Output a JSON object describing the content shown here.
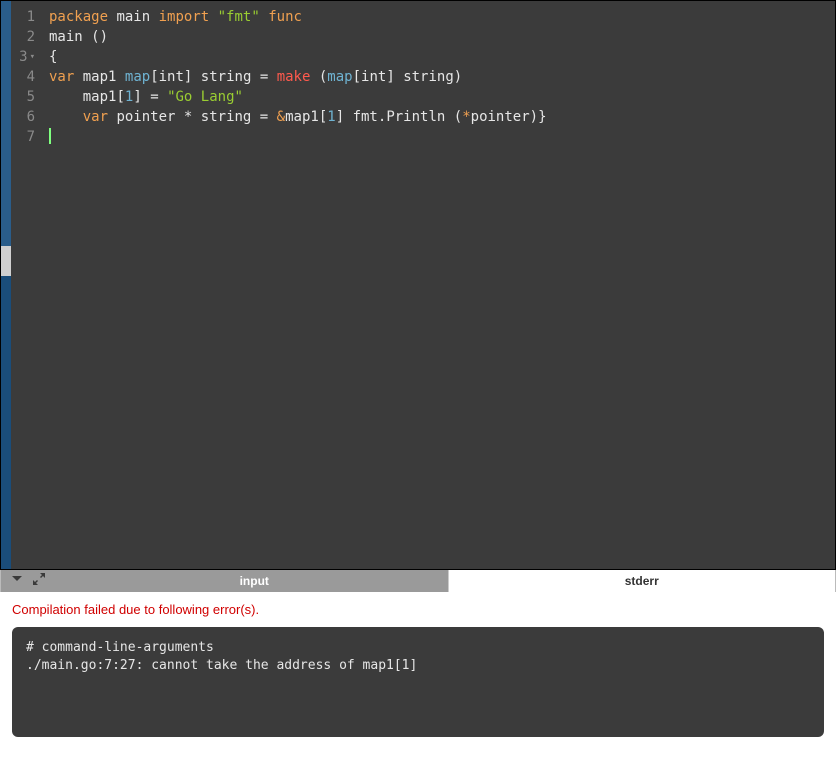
{
  "editor": {
    "lines": [
      {
        "num": "1",
        "tokens": [
          {
            "cls": "kw-package",
            "t": "package"
          },
          {
            "cls": "sp",
            "t": " "
          },
          {
            "cls": "name-main",
            "t": "main"
          },
          {
            "cls": "sp",
            "t": " "
          },
          {
            "cls": "kw-import",
            "t": "import"
          },
          {
            "cls": "sp",
            "t": " "
          },
          {
            "cls": "str",
            "t": "\"fmt\""
          },
          {
            "cls": "sp",
            "t": " "
          },
          {
            "cls": "kw-func",
            "t": "func"
          }
        ]
      },
      {
        "num": "2",
        "tokens": [
          {
            "cls": "name-main",
            "t": "main"
          },
          {
            "cls": "sp",
            "t": " "
          },
          {
            "cls": "punct",
            "t": "()"
          }
        ]
      },
      {
        "num": "3",
        "fold": true,
        "tokens": [
          {
            "cls": "punct",
            "t": "{"
          }
        ]
      },
      {
        "num": "4",
        "tokens": [
          {
            "cls": "kw-var",
            "t": "var"
          },
          {
            "cls": "sp",
            "t": " "
          },
          {
            "cls": "ident",
            "t": "map1"
          },
          {
            "cls": "sp",
            "t": " "
          },
          {
            "cls": "mapkw",
            "t": "map"
          },
          {
            "cls": "punct",
            "t": "["
          },
          {
            "cls": "ident",
            "t": "int"
          },
          {
            "cls": "punct",
            "t": "]"
          },
          {
            "cls": "sp",
            "t": " "
          },
          {
            "cls": "ident",
            "t": "string"
          },
          {
            "cls": "sp",
            "t": " "
          },
          {
            "cls": "punct",
            "t": "="
          },
          {
            "cls": "sp",
            "t": " "
          },
          {
            "cls": "kw-make",
            "t": "make"
          },
          {
            "cls": "sp",
            "t": " "
          },
          {
            "cls": "punct",
            "t": "("
          },
          {
            "cls": "mapkw",
            "t": "map"
          },
          {
            "cls": "punct",
            "t": "["
          },
          {
            "cls": "ident",
            "t": "int"
          },
          {
            "cls": "punct",
            "t": "]"
          },
          {
            "cls": "sp",
            "t": " "
          },
          {
            "cls": "ident",
            "t": "string"
          },
          {
            "cls": "punct",
            "t": ")"
          }
        ]
      },
      {
        "num": "5",
        "tokens": [
          {
            "cls": "sp",
            "t": "    "
          },
          {
            "cls": "ident",
            "t": "map1"
          },
          {
            "cls": "punct",
            "t": "["
          },
          {
            "cls": "num",
            "t": "1"
          },
          {
            "cls": "punct",
            "t": "]"
          },
          {
            "cls": "sp",
            "t": " "
          },
          {
            "cls": "punct",
            "t": "="
          },
          {
            "cls": "sp",
            "t": " "
          },
          {
            "cls": "str",
            "t": "\"Go Lang\""
          }
        ]
      },
      {
        "num": "6",
        "tokens": [
          {
            "cls": "sp",
            "t": "    "
          },
          {
            "cls": "kw-var",
            "t": "var"
          },
          {
            "cls": "sp",
            "t": " "
          },
          {
            "cls": "ident",
            "t": "pointer"
          },
          {
            "cls": "sp",
            "t": " "
          },
          {
            "cls": "punct",
            "t": "*"
          },
          {
            "cls": "sp",
            "t": " "
          },
          {
            "cls": "ident",
            "t": "string"
          },
          {
            "cls": "sp",
            "t": " "
          },
          {
            "cls": "punct",
            "t": "="
          },
          {
            "cls": "sp",
            "t": " "
          },
          {
            "cls": "amp",
            "t": "&"
          },
          {
            "cls": "ident",
            "t": "map1"
          },
          {
            "cls": "punct",
            "t": "["
          },
          {
            "cls": "num",
            "t": "1"
          },
          {
            "cls": "punct",
            "t": "]"
          },
          {
            "cls": "sp",
            "t": " "
          },
          {
            "cls": "ident",
            "t": "fmt"
          },
          {
            "cls": "punct",
            "t": "."
          },
          {
            "cls": "ident",
            "t": "Println"
          },
          {
            "cls": "sp",
            "t": " "
          },
          {
            "cls": "punct",
            "t": "("
          },
          {
            "cls": "star",
            "t": "*"
          },
          {
            "cls": "ident",
            "t": "pointer"
          },
          {
            "cls": "punct",
            "t": ")}"
          }
        ]
      },
      {
        "num": "7",
        "tokens": [],
        "cursor": true
      }
    ]
  },
  "tabs": {
    "input": "input",
    "stderr": "stderr"
  },
  "output": {
    "error_heading": "Compilation failed due to following error(s).",
    "console_text": "# command-line-arguments\n./main.go:7:27: cannot take the address of map1[1]"
  }
}
